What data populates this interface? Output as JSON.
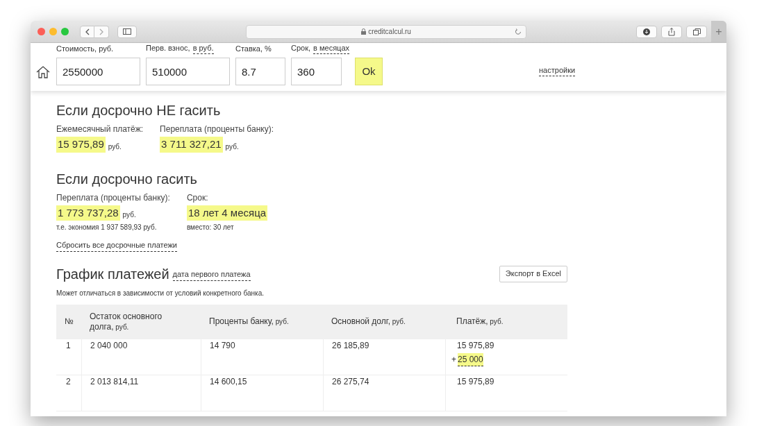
{
  "browser": {
    "url": "creditcalcul.ru",
    "new_tab": "+"
  },
  "form": {
    "fields": [
      {
        "label": "Стоимость, руб.",
        "value": "2550000"
      },
      {
        "label": "Перв. взнос,",
        "link": "в руб.",
        "value": "510000"
      },
      {
        "label": "Ставка, %",
        "value": "8.7"
      },
      {
        "label": "Срок,",
        "link": "в месяцах",
        "value": "360"
      }
    ],
    "submit": "Ok",
    "settings": "настройки"
  },
  "no_early": {
    "title": "Если досрочно НЕ гасить",
    "items": [
      {
        "label": "Ежемесячный платёж:",
        "value": "15 975,89",
        "unit": "руб."
      },
      {
        "label": "Переплата (проценты банку):",
        "value": "3 711 327,21",
        "unit": "руб."
      }
    ]
  },
  "early": {
    "title": "Если досрочно гасить",
    "items": [
      {
        "label": "Переплата (проценты банку):",
        "value": "1 773 737,28",
        "unit": "руб.",
        "note": "т.е. экономия 1 937 589,93 руб."
      },
      {
        "label": "Срок:",
        "value": "18 лет 4 месяца",
        "note": "вместо: 30 лет"
      }
    ],
    "reset": "Сбросить все досрочные платежи"
  },
  "schedule": {
    "title": "График платежей",
    "date_link": "дата первого платежа",
    "export": "Экспорт в Excel",
    "note": "Может отличаться в зависимости от условий конкретного банка.",
    "columns": [
      {
        "main": "№"
      },
      {
        "main": "Остаток основного долга,",
        "unit": "руб."
      },
      {
        "main": "Проценты банку,",
        "unit": "руб."
      },
      {
        "main": "Основной долг,",
        "unit": "руб."
      },
      {
        "main": "Платёж,",
        "unit": "руб."
      }
    ],
    "rows": [
      {
        "cells": [
          "1",
          "2 040 000",
          "14 790",
          "26 185,89",
          "15 975,89"
        ],
        "extra": "25 000",
        "extra_sign": "+"
      },
      {
        "cells": [
          "2",
          "2 013 814,11",
          "14 600,15",
          "26 275,74",
          "15 975,89"
        ]
      }
    ]
  }
}
